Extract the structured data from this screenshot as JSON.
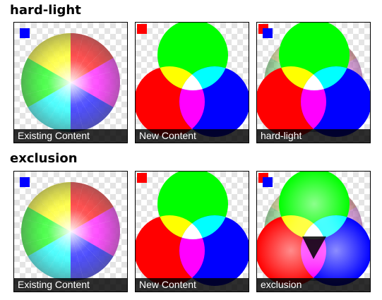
{
  "sections": [
    {
      "title": "hard-light",
      "panels": [
        {
          "caption": "Existing Content",
          "kind": "existing"
        },
        {
          "caption": "New Content",
          "kind": "new"
        },
        {
          "caption": "hard-light",
          "kind": "result"
        }
      ]
    },
    {
      "title": "exclusion",
      "panels": [
        {
          "caption": "Existing Content",
          "kind": "existing"
        },
        {
          "caption": "New Content",
          "kind": "new"
        },
        {
          "caption": "exclusion",
          "kind": "result"
        }
      ]
    }
  ],
  "colors": {
    "red": "#ff0000",
    "green": "#00ff00",
    "blue": "#0000ff",
    "yellow": "#ffff00",
    "cyan": "#00ffff",
    "magenta": "#ff00ff",
    "white": "#ffffff",
    "checker": "#e4e4e4"
  }
}
